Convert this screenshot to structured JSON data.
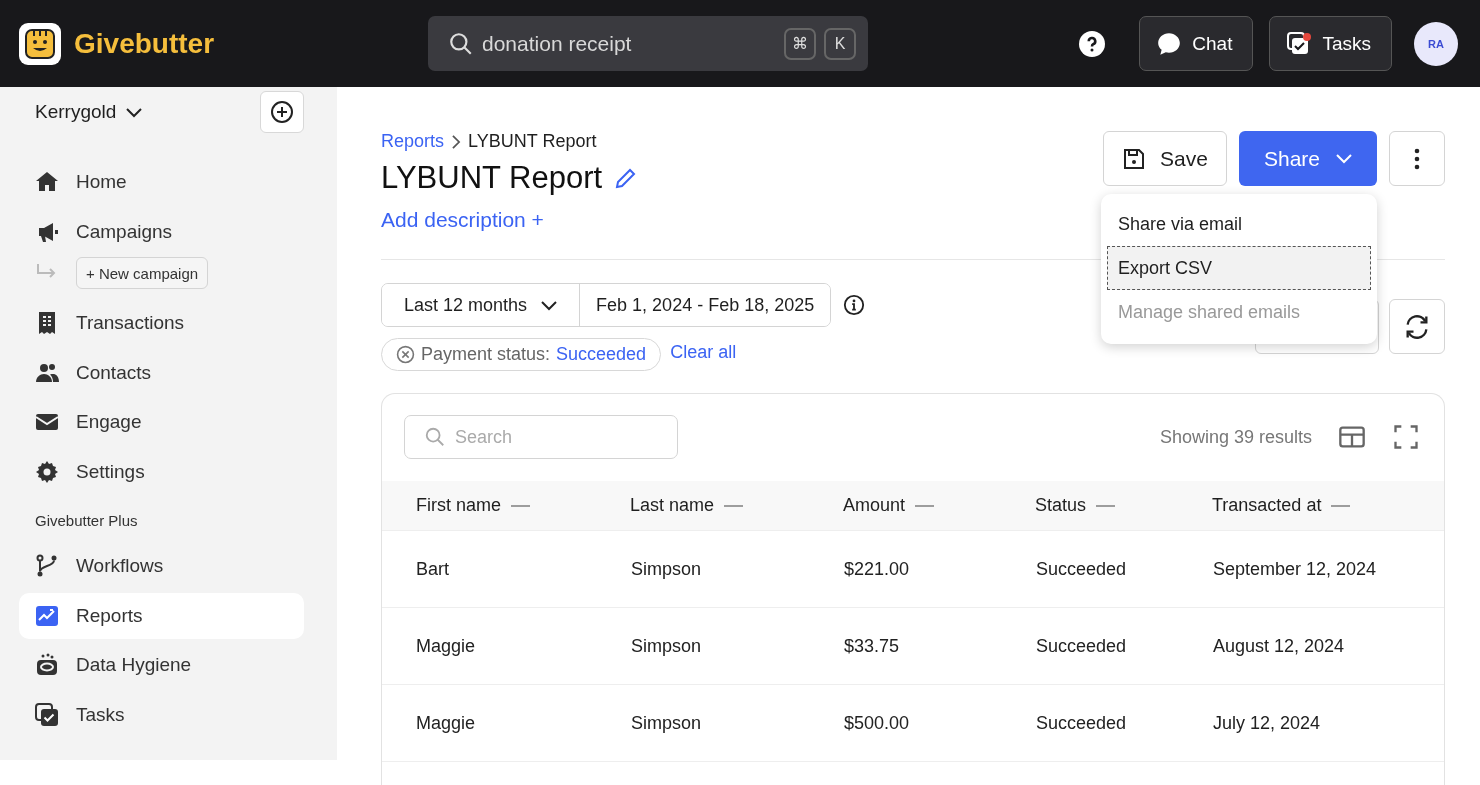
{
  "topbar": {
    "brand": "Givebutter",
    "search": {
      "value": "donation receipt",
      "shortcut_keys": [
        "⌘",
        "K"
      ]
    },
    "chat_button": "Chat",
    "tasks_button": {
      "label": "Tasks",
      "has_notification": true
    },
    "avatar": "RA"
  },
  "sidebar": {
    "organization": "Kerrygold",
    "items": [
      {
        "label": "Home",
        "selected": false
      },
      {
        "label": "Campaigns",
        "selected": false
      },
      {
        "label": "Transactions",
        "selected": false
      },
      {
        "label": "Contacts",
        "selected": false
      },
      {
        "label": "Engage",
        "selected": false
      },
      {
        "label": "Settings",
        "selected": false
      }
    ],
    "new_campaign_button": "+ New campaign",
    "section_heading": "Givebutter Plus",
    "plus_items": [
      {
        "label": "Workflows",
        "selected": false
      },
      {
        "label": "Reports",
        "selected": true
      },
      {
        "label": "Data Hygiene",
        "selected": false
      },
      {
        "label": "Tasks",
        "selected": false
      }
    ]
  },
  "breadcrumb": [
    {
      "label": "Reports",
      "kind": "link"
    },
    {
      "label": "LYBUNT Report",
      "kind": "current"
    }
  ],
  "title": "LYBUNT Report",
  "add_description": "Add description +",
  "actions": {
    "save": "Save",
    "share": "Share"
  },
  "share_menu": [
    {
      "label": "Share via email",
      "selected": false,
      "disabled": false
    },
    {
      "label": "Export CSV",
      "selected": true,
      "disabled": false
    },
    {
      "label": "Manage shared emails",
      "selected": false,
      "disabled": true
    }
  ],
  "date_range": {
    "preset": "Last 12 months",
    "range": "Feb 1, 2024 - Feb 18, 2025"
  },
  "filter_chip": {
    "label": "Payment status:",
    "value": "Succeeded"
  },
  "clear_all": "Clear all",
  "table": {
    "search": {
      "placeholder": "Search"
    },
    "results": "Showing 39 results",
    "columns": [
      "First name",
      "Last name",
      "Amount",
      "Status",
      "Transacted at"
    ],
    "rows": [
      [
        "Bart",
        "Simpson",
        "$221.00",
        "Succeeded",
        "September 12, 2024"
      ],
      [
        "Maggie",
        "Simpson",
        "$33.75",
        "Succeeded",
        "August 12, 2024"
      ],
      [
        "Maggie",
        "Simpson",
        "$500.00",
        "Succeeded",
        "July 12, 2024"
      ]
    ]
  }
}
